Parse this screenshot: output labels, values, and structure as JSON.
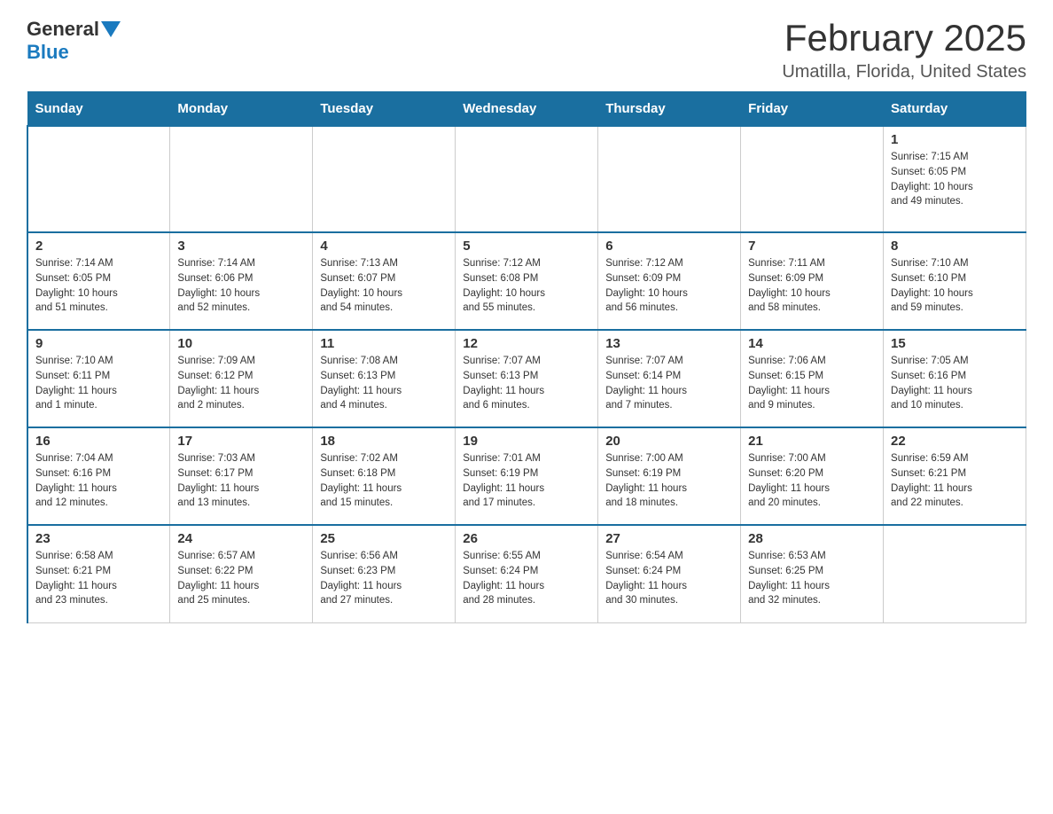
{
  "header": {
    "logo": {
      "general": "General",
      "blue": "Blue"
    },
    "title": "February 2025",
    "location": "Umatilla, Florida, United States"
  },
  "weekdays": [
    "Sunday",
    "Monday",
    "Tuesday",
    "Wednesday",
    "Thursday",
    "Friday",
    "Saturday"
  ],
  "weeks": [
    {
      "days": [
        {
          "number": "",
          "info": ""
        },
        {
          "number": "",
          "info": ""
        },
        {
          "number": "",
          "info": ""
        },
        {
          "number": "",
          "info": ""
        },
        {
          "number": "",
          "info": ""
        },
        {
          "number": "",
          "info": ""
        },
        {
          "number": "1",
          "info": "Sunrise: 7:15 AM\nSunset: 6:05 PM\nDaylight: 10 hours\nand 49 minutes."
        }
      ]
    },
    {
      "days": [
        {
          "number": "2",
          "info": "Sunrise: 7:14 AM\nSunset: 6:05 PM\nDaylight: 10 hours\nand 51 minutes."
        },
        {
          "number": "3",
          "info": "Sunrise: 7:14 AM\nSunset: 6:06 PM\nDaylight: 10 hours\nand 52 minutes."
        },
        {
          "number": "4",
          "info": "Sunrise: 7:13 AM\nSunset: 6:07 PM\nDaylight: 10 hours\nand 54 minutes."
        },
        {
          "number": "5",
          "info": "Sunrise: 7:12 AM\nSunset: 6:08 PM\nDaylight: 10 hours\nand 55 minutes."
        },
        {
          "number": "6",
          "info": "Sunrise: 7:12 AM\nSunset: 6:09 PM\nDaylight: 10 hours\nand 56 minutes."
        },
        {
          "number": "7",
          "info": "Sunrise: 7:11 AM\nSunset: 6:09 PM\nDaylight: 10 hours\nand 58 minutes."
        },
        {
          "number": "8",
          "info": "Sunrise: 7:10 AM\nSunset: 6:10 PM\nDaylight: 10 hours\nand 59 minutes."
        }
      ]
    },
    {
      "days": [
        {
          "number": "9",
          "info": "Sunrise: 7:10 AM\nSunset: 6:11 PM\nDaylight: 11 hours\nand 1 minute."
        },
        {
          "number": "10",
          "info": "Sunrise: 7:09 AM\nSunset: 6:12 PM\nDaylight: 11 hours\nand 2 minutes."
        },
        {
          "number": "11",
          "info": "Sunrise: 7:08 AM\nSunset: 6:13 PM\nDaylight: 11 hours\nand 4 minutes."
        },
        {
          "number": "12",
          "info": "Sunrise: 7:07 AM\nSunset: 6:13 PM\nDaylight: 11 hours\nand 6 minutes."
        },
        {
          "number": "13",
          "info": "Sunrise: 7:07 AM\nSunset: 6:14 PM\nDaylight: 11 hours\nand 7 minutes."
        },
        {
          "number": "14",
          "info": "Sunrise: 7:06 AM\nSunset: 6:15 PM\nDaylight: 11 hours\nand 9 minutes."
        },
        {
          "number": "15",
          "info": "Sunrise: 7:05 AM\nSunset: 6:16 PM\nDaylight: 11 hours\nand 10 minutes."
        }
      ]
    },
    {
      "days": [
        {
          "number": "16",
          "info": "Sunrise: 7:04 AM\nSunset: 6:16 PM\nDaylight: 11 hours\nand 12 minutes."
        },
        {
          "number": "17",
          "info": "Sunrise: 7:03 AM\nSunset: 6:17 PM\nDaylight: 11 hours\nand 13 minutes."
        },
        {
          "number": "18",
          "info": "Sunrise: 7:02 AM\nSunset: 6:18 PM\nDaylight: 11 hours\nand 15 minutes."
        },
        {
          "number": "19",
          "info": "Sunrise: 7:01 AM\nSunset: 6:19 PM\nDaylight: 11 hours\nand 17 minutes."
        },
        {
          "number": "20",
          "info": "Sunrise: 7:00 AM\nSunset: 6:19 PM\nDaylight: 11 hours\nand 18 minutes."
        },
        {
          "number": "21",
          "info": "Sunrise: 7:00 AM\nSunset: 6:20 PM\nDaylight: 11 hours\nand 20 minutes."
        },
        {
          "number": "22",
          "info": "Sunrise: 6:59 AM\nSunset: 6:21 PM\nDaylight: 11 hours\nand 22 minutes."
        }
      ]
    },
    {
      "days": [
        {
          "number": "23",
          "info": "Sunrise: 6:58 AM\nSunset: 6:21 PM\nDaylight: 11 hours\nand 23 minutes."
        },
        {
          "number": "24",
          "info": "Sunrise: 6:57 AM\nSunset: 6:22 PM\nDaylight: 11 hours\nand 25 minutes."
        },
        {
          "number": "25",
          "info": "Sunrise: 6:56 AM\nSunset: 6:23 PM\nDaylight: 11 hours\nand 27 minutes."
        },
        {
          "number": "26",
          "info": "Sunrise: 6:55 AM\nSunset: 6:24 PM\nDaylight: 11 hours\nand 28 minutes."
        },
        {
          "number": "27",
          "info": "Sunrise: 6:54 AM\nSunset: 6:24 PM\nDaylight: 11 hours\nand 30 minutes."
        },
        {
          "number": "28",
          "info": "Sunrise: 6:53 AM\nSunset: 6:25 PM\nDaylight: 11 hours\nand 32 minutes."
        },
        {
          "number": "",
          "info": ""
        }
      ]
    }
  ]
}
